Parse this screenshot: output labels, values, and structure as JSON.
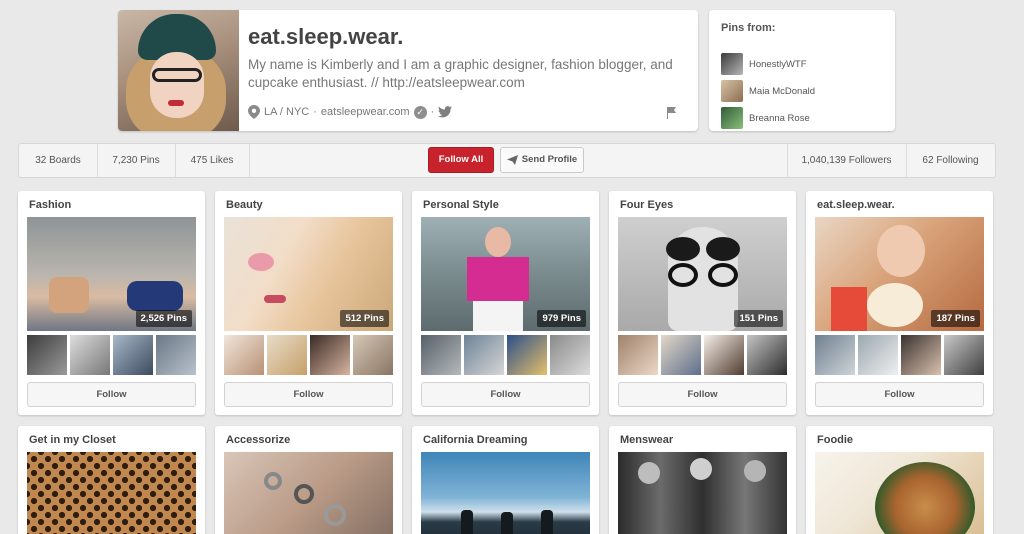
{
  "profile": {
    "name": "eat.sleep.wear.",
    "bio": "My name is Kimberly and I am a graphic designer, fashion blogger, and cupcake enthusiast. // http://eatsleepwear.com",
    "location": "LA / NYC",
    "website": "eatsleepwear.com",
    "separator": "·",
    "icons": [
      "location-pin-icon",
      "verified-icon",
      "twitter-icon",
      "report-flag-icon"
    ]
  },
  "pins_from": {
    "title": "Pins from:",
    "items": [
      {
        "name": "HonestlyWTF"
      },
      {
        "name": "Maia McDonald"
      },
      {
        "name": "Breanna Rose"
      }
    ]
  },
  "stats": {
    "boards": "32 Boards",
    "pins": "7,230 Pins",
    "likes": "475 Likes",
    "followers": "1,040,139 Followers",
    "following": "62 Following",
    "follow_all": "Follow All",
    "send_profile": "Send Profile"
  },
  "colors": {
    "accent": "#c8232c",
    "background": "#e9e9e9"
  },
  "boards": [
    {
      "title": "Fashion",
      "count": "2,526 Pins",
      "follow": "Follow"
    },
    {
      "title": "Beauty",
      "count": "512 Pins",
      "follow": "Follow"
    },
    {
      "title": "Personal Style",
      "count": "979 Pins",
      "follow": "Follow"
    },
    {
      "title": "Four Eyes",
      "count": "151 Pins",
      "follow": "Follow"
    },
    {
      "title": "eat.sleep.wear.",
      "count": "187 Pins",
      "follow": "Follow"
    },
    {
      "title": "Get in my Closet"
    },
    {
      "title": "Accessorize"
    },
    {
      "title": "California Dreaming"
    },
    {
      "title": "Menswear"
    },
    {
      "title": "Foodie"
    }
  ]
}
